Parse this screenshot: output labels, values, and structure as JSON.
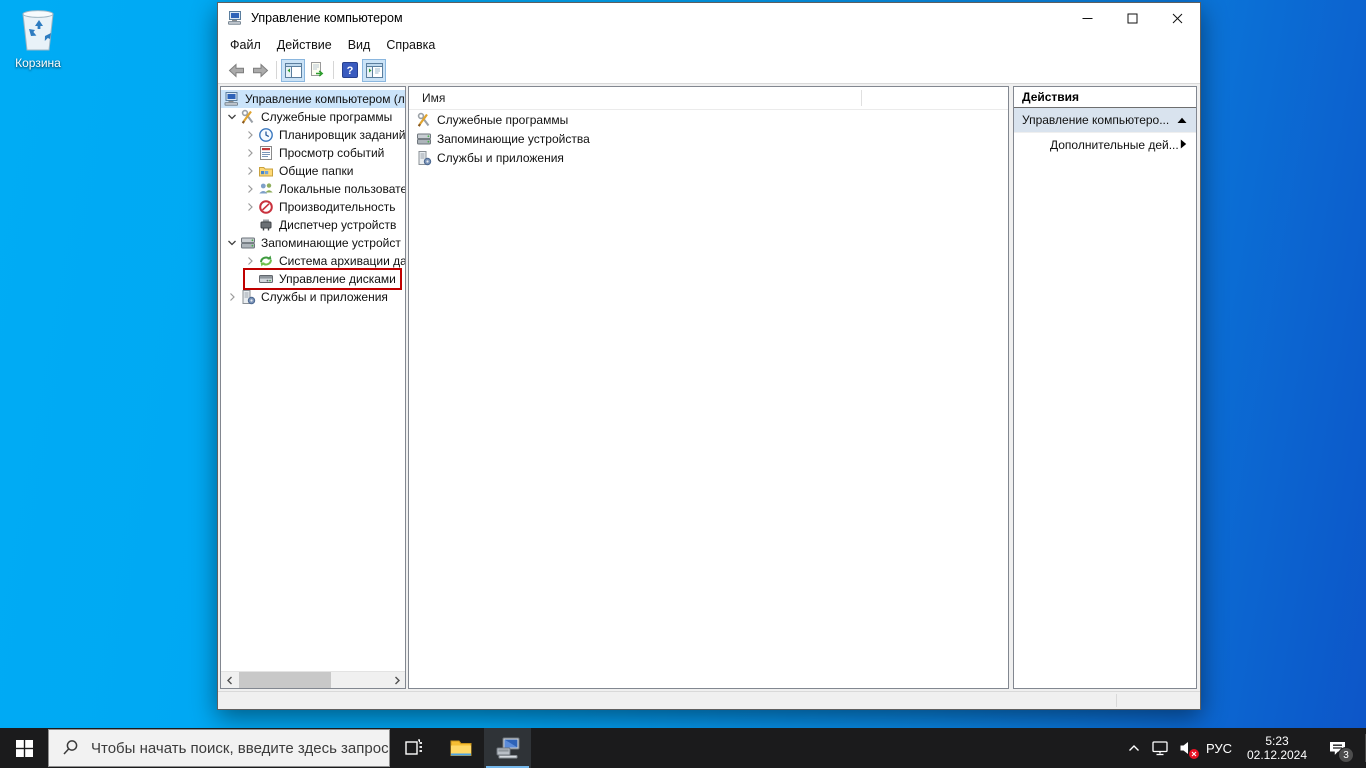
{
  "desktop": {
    "recycle_bin_label": "Корзина"
  },
  "window": {
    "title": "Управление компьютером",
    "menu": {
      "file": "Файл",
      "action": "Действие",
      "view": "Вид",
      "help": "Справка"
    },
    "tree": {
      "items": [
        {
          "label": "Управление компьютером (л",
          "level": 0,
          "state": "selected"
        },
        {
          "label": "Служебные программы",
          "level": 1,
          "state": "expanded"
        },
        {
          "label": "Планировщик заданий",
          "level": 2,
          "state": "collapsed"
        },
        {
          "label": "Просмотр событий",
          "level": 2,
          "state": "collapsed"
        },
        {
          "label": "Общие папки",
          "level": 2,
          "state": "collapsed"
        },
        {
          "label": "Локальные пользовате",
          "level": 2,
          "state": "collapsed"
        },
        {
          "label": "Производительность",
          "level": 2,
          "state": "collapsed"
        },
        {
          "label": "Диспетчер устройств",
          "level": 2,
          "state": "leaf"
        },
        {
          "label": "Запоминающие устройст",
          "level": 1,
          "state": "expanded"
        },
        {
          "label": "Система архивации да",
          "level": 2,
          "state": "collapsed"
        },
        {
          "label": "Управление дисками",
          "level": 2,
          "state": "leaf-highlighted-red"
        },
        {
          "label": "Службы и приложения",
          "level": 1,
          "state": "collapsed"
        }
      ]
    },
    "list": {
      "column_header": "Имя",
      "items": [
        {
          "label": "Служебные программы"
        },
        {
          "label": "Запоминающие устройства"
        },
        {
          "label": "Службы и приложения"
        }
      ]
    },
    "actions": {
      "header": "Действия",
      "rows": [
        {
          "label": "Управление компьютеро...",
          "arrow": "up"
        },
        {
          "label": "Дополнительные дей...",
          "arrow": "right"
        }
      ]
    }
  },
  "taskbar": {
    "search_placeholder": "Чтобы начать поиск, введите здесь запрос",
    "language_indicator": "РУС",
    "time": "5:23",
    "date": "02.12.2024",
    "notification_badge": "3"
  },
  "colors": {
    "desktop_left": "#00ACF4",
    "desktop_right": "#0D55C8",
    "taskbar": "#1B1B1C",
    "tree_selection": "#CBE4FA",
    "red_highlight": "#C00000",
    "action_row_selected": "#D9E3EE"
  }
}
